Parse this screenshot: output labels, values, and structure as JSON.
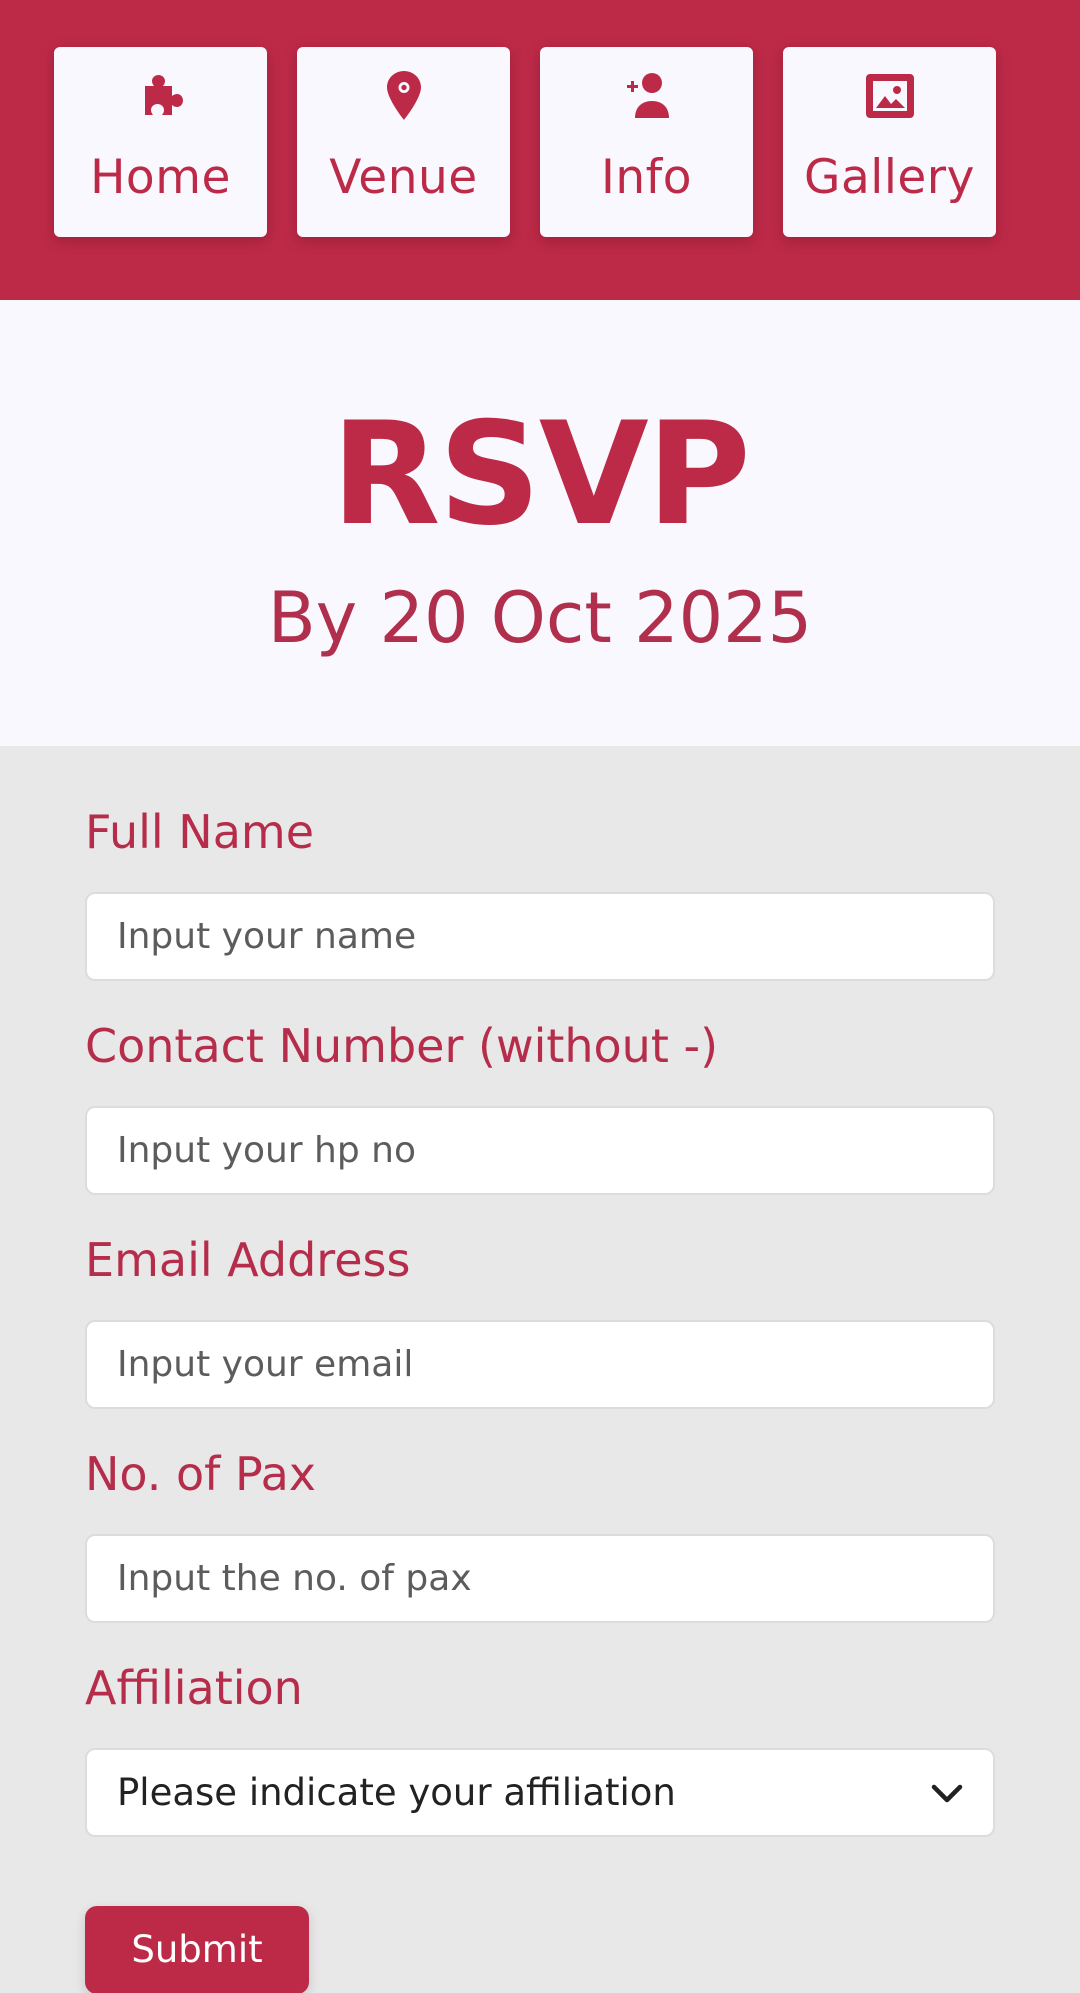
{
  "colors": {
    "brand": "#bd2a48",
    "hero_bg": "#f8f8fe",
    "form_bg": "#e9e8e9"
  },
  "nav": {
    "items": [
      {
        "label": "Home",
        "icon": "puzzle-icon"
      },
      {
        "label": "Venue",
        "icon": "map-pin-icon"
      },
      {
        "label": "Info",
        "icon": "add-user-icon"
      },
      {
        "label": "Gallery",
        "icon": "image-icon"
      }
    ]
  },
  "hero": {
    "title": "RSVP",
    "subtitle": "By 20 Oct 2025"
  },
  "form": {
    "name": {
      "label": "Full Name",
      "placeholder": "Input your name"
    },
    "contact": {
      "label": "Contact Number (without -)",
      "placeholder": "Input your hp no"
    },
    "email": {
      "label": "Email Address",
      "placeholder": "Input your email"
    },
    "pax": {
      "label": "No. of Pax",
      "placeholder": "Input the no. of pax"
    },
    "affiliation": {
      "label": "Affiliation",
      "selected": "Please indicate your affiliation"
    },
    "submit_label": "Submit"
  }
}
